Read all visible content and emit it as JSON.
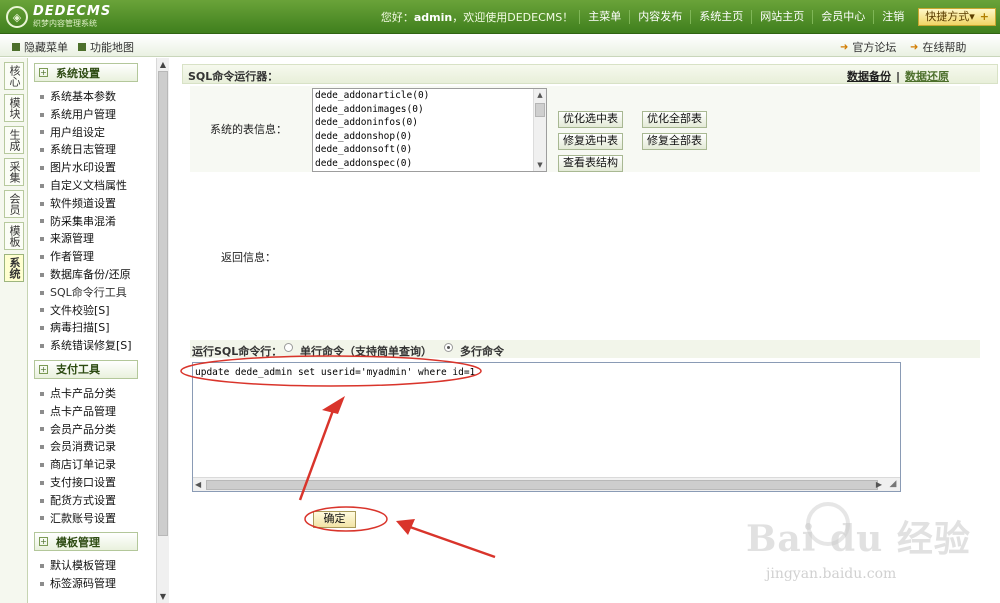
{
  "header": {
    "logo_title": "DEDECMS",
    "logo_subtitle": "织梦内容管理系统",
    "welcome_prefix": "您好：",
    "welcome_user": "admin",
    "welcome_suffix": "，欢迎使用DEDECMS！",
    "nav": [
      "主菜单",
      "内容发布",
      "系统主页",
      "网站主页",
      "会员中心",
      "注销"
    ],
    "quick_label": "快捷方式▾",
    "quick_plus": "+"
  },
  "subbar": {
    "hide_menu": "隐藏菜单",
    "func_map": "功能地图",
    "official_forum": "官方论坛",
    "online_help": "在线帮助"
  },
  "vtabs": [
    "核心",
    "模块",
    "生成",
    "采集",
    "会员",
    "模板",
    "系统"
  ],
  "vtab_active": "系统",
  "sidemenu": {
    "groups": [
      {
        "title": "系统设置",
        "items": [
          "系统基本参数",
          "系统用户管理",
          "用户组设定",
          "系统日志管理",
          "图片水印设置",
          "自定义文档属性",
          "软件频道设置",
          "防采集串混淆",
          "来源管理",
          "作者管理",
          "数据库备份/还原",
          "SQL命令行工具",
          "文件校验[S]",
          "病毒扫描[S]",
          "系统错误修复[S]"
        ]
      },
      {
        "title": "支付工具",
        "items": [
          "点卡产品分类",
          "点卡产品管理",
          "会员产品分类",
          "会员消费记录",
          "商店订单记录",
          "支付接口设置",
          "配货方式设置",
          "汇款账号设置"
        ]
      },
      {
        "title": "模板管理",
        "items": [
          "默认模板管理",
          "标签源码管理"
        ]
      }
    ]
  },
  "main": {
    "panel_title": "SQL命令运行器：",
    "link_backup": "数据备份",
    "link_sep": "|",
    "link_restore": "数据还原",
    "table_info_label": "系统的表信息：",
    "tables": [
      "dede_addonarticle(0)",
      "dede_addonimages(0)",
      "dede_addoninfos(0)",
      "dede_addonshop(0)",
      "dede_addonsoft(0)",
      "dede_addonspec(0)"
    ],
    "btn_opt_selected": "优化选中表",
    "btn_opt_all": "优化全部表",
    "btn_repair_selected": "修复选中表",
    "btn_repair_all": "修复全部表",
    "btn_view_struct": "查看表结构",
    "return_label": "返回信息：",
    "run_label": "运行SQL命令行：",
    "radio_single": "单行命令（支持简单查询）",
    "radio_multi": "多行命令",
    "radio_selected": "多行命令",
    "sql_text": "update dede_admin set userid='myadmin' where id=1",
    "ok_button": "确定"
  },
  "watermark": {
    "brand": "Bai du 经验",
    "url": "jingyan.baidu.com"
  },
  "colors": {
    "header_green": "#4f8c26",
    "annotation_red": "#d9342b"
  }
}
